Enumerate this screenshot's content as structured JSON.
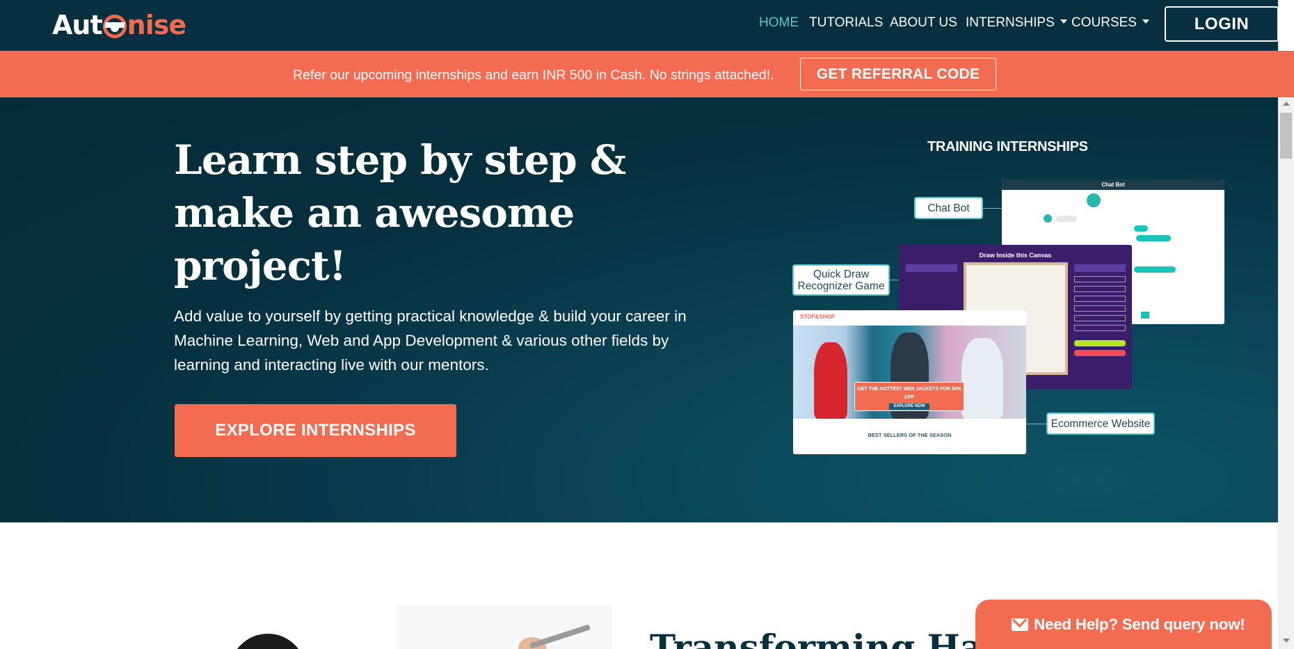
{
  "brand": {
    "logo_part1": "Aut",
    "logo_part2": "nise"
  },
  "nav": {
    "items": [
      {
        "label": "HOME",
        "active": true
      },
      {
        "label": "TUTORIALS",
        "active": false
      },
      {
        "label": "ABOUT US",
        "active": false
      },
      {
        "label": "INTERNSHIPS",
        "active": false,
        "dropdown": true
      },
      {
        "label": "COURSES",
        "active": false,
        "dropdown": true
      }
    ],
    "login_label": "LOGIN"
  },
  "referral": {
    "text": "Refer our upcoming internships and earn INR 500 in Cash. No strings attached!.",
    "button_label": "GET REFERRAL CODE"
  },
  "hero": {
    "title": "Learn step by step & make an awesome project!",
    "description": "Add value to yourself by getting practical knowledge & build your career in Machine Learning, Web and App Development & various other fields by learning and interacting live with our mentors.",
    "cta_label": "EXPLORE INTERNSHIPS",
    "showcase_title": "TRAINING INTERNSHIPS",
    "callouts": {
      "chatbot": "Chat Bot",
      "quickdraw": "Quick Draw Recognizer  Game",
      "ecommerce": "Ecommerce Website"
    },
    "panels": {
      "chatbot_header": "Chat Bot",
      "quickdraw_header": "Draw Inside this Canvas",
      "shop_brand": "STOP&SHOP",
      "shop_banner": "GET THE HOTTEST MEN JACKETS FOR 50% OFF",
      "shop_banner_cta": "EXPLORE NOW",
      "shop_subtitle": "BEST SELLERS OF THE SEASON"
    }
  },
  "lower": {
    "title_partial": "Transforming Ha"
  },
  "help": {
    "label": "Need Help? Send query now!"
  },
  "colors": {
    "navy": "#062f3f",
    "accent": "#f36b51",
    "teal": "#5bc7d0"
  }
}
